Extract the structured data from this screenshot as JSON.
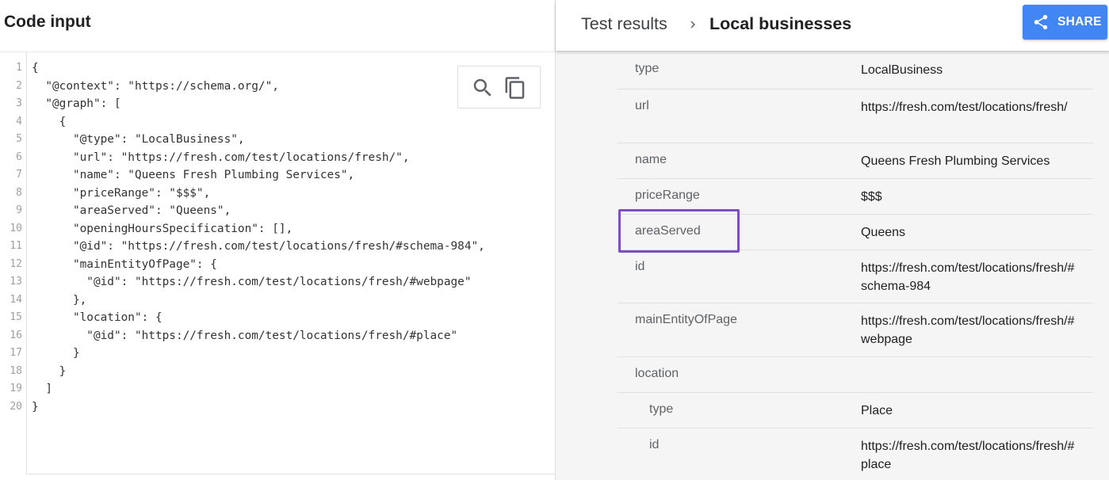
{
  "left_panel": {
    "title": "Code input",
    "line_numbers": [
      "1",
      "2",
      "3",
      "4",
      "5",
      "6",
      "7",
      "8",
      "9",
      "10",
      "11",
      "12",
      "13",
      "14",
      "15",
      "16",
      "17",
      "18",
      "19",
      "20"
    ],
    "code_lines": [
      "{",
      "  \"@context\": \"https://schema.org/\",",
      "  \"@graph\": [",
      "    {",
      "      \"@type\": \"LocalBusiness\",",
      "      \"url\": \"https://fresh.com/test/locations/fresh/\",",
      "      \"name\": \"Queens Fresh Plumbing Services\",",
      "      \"priceRange\": \"$$$\",",
      "      \"areaServed\": \"Queens\",",
      "      \"openingHoursSpecification\": [],",
      "      \"@id\": \"https://fresh.com/test/locations/fresh/#schema-984\",",
      "      \"mainEntityOfPage\": {",
      "        \"@id\": \"https://fresh.com/test/locations/fresh/#webpage\"",
      "      },",
      "      \"location\": {",
      "        \"@id\": \"https://fresh.com/test/locations/fresh/#place\"",
      "      }",
      "    }",
      "  ]",
      "}"
    ],
    "tools": [
      {
        "icon": "search-icon"
      },
      {
        "icon": "copy-icon"
      }
    ]
  },
  "right_panel": {
    "breadcrumb": {
      "parent": "Test results",
      "separator_icon": "chevron-right-icon",
      "current": "Local businesses"
    },
    "share_button": {
      "label": "SHARE",
      "icon": "share-icon",
      "color": "#4285f4"
    },
    "rows": [
      {
        "property": "type",
        "value": "LocalBusiness",
        "indent": false
      },
      {
        "property": "url",
        "value": "https://fresh.com/test/locations/fresh/",
        "indent": false
      },
      {
        "property": "name",
        "value": "Queens Fresh Plumbing Services",
        "indent": false
      },
      {
        "property": "priceRange",
        "value": "$$$",
        "indent": false
      },
      {
        "property": "areaServed",
        "value": "Queens",
        "indent": false,
        "highlighted": true
      },
      {
        "property": "id",
        "value": "https://fresh.com/test/locations/fresh/#schema-984",
        "indent": false
      },
      {
        "property": "mainEntityOfPage",
        "value": "https://fresh.com/test/locations/fresh/#webpage",
        "indent": false
      },
      {
        "property": "location",
        "value": "",
        "indent": false
      },
      {
        "property": "type",
        "value": "Place",
        "indent": true
      },
      {
        "property": "id",
        "value": "https://fresh.com/test/locations/fresh/#place",
        "indent": true
      }
    ],
    "highlight_color": "#7b4fc0"
  }
}
